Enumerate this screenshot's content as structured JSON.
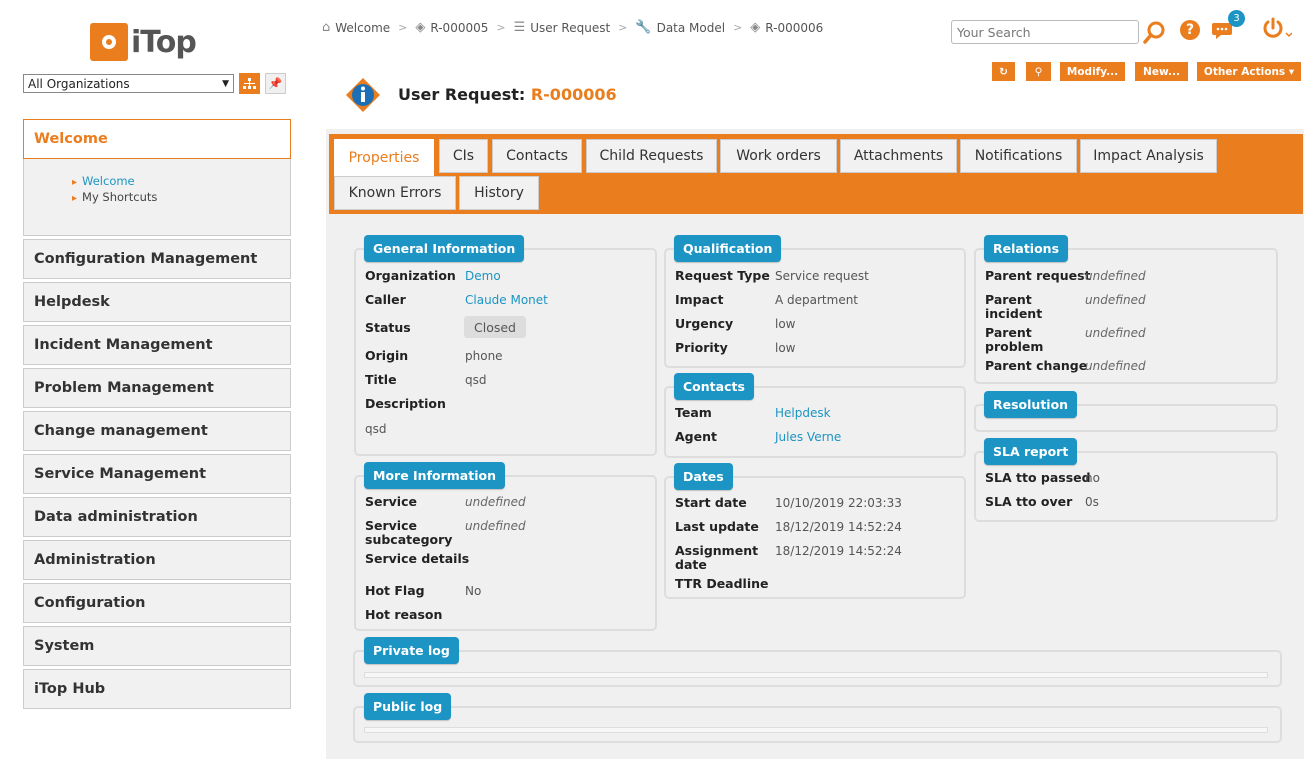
{
  "app": {
    "logo_text": "iTop"
  },
  "sidebar": {
    "org_select": "All Organizations",
    "welcome": {
      "label": "Welcome",
      "items": [
        "Welcome",
        "My Shortcuts"
      ]
    },
    "menus": [
      "Configuration Management",
      "Helpdesk",
      "Incident Management",
      "Problem Management",
      "Change management",
      "Service Management",
      "Data administration",
      "Administration",
      "Configuration",
      "System",
      "iTop Hub"
    ]
  },
  "breadcrumb": [
    "Welcome",
    "R-000005",
    "User Request",
    "Data Model",
    "R-000006"
  ],
  "header": {
    "search_placeholder": "Your Search",
    "notifications_count": "3",
    "help": "?"
  },
  "actions": {
    "refresh": "↻",
    "search": "⚲",
    "modify": "Modify...",
    "new": "New...",
    "other": "Other Actions ▾"
  },
  "title": {
    "prefix": "User Request:",
    "ref": "R-000006"
  },
  "tabs": [
    "Properties",
    "CIs",
    "Contacts",
    "Child Requests",
    "Work orders",
    "Attachments",
    "Notifications",
    "Impact Analysis",
    "Known Errors",
    "History"
  ],
  "general": {
    "legend": "General Information",
    "fields": {
      "organization": {
        "label": "Organization",
        "value": "Demo"
      },
      "caller": {
        "label": "Caller",
        "value": "Claude Monet"
      },
      "status": {
        "label": "Status",
        "value": "Closed"
      },
      "origin": {
        "label": "Origin",
        "value": "phone"
      },
      "title": {
        "label": "Title",
        "value": "qsd"
      },
      "description": {
        "label": "Description",
        "value": "qsd"
      }
    }
  },
  "more": {
    "legend": "More Information",
    "fields": {
      "service": {
        "label": "Service",
        "value": "undefined"
      },
      "subcategory": {
        "label": "Service subcategory",
        "value": "undefined"
      },
      "details": {
        "label": "Service details",
        "value": ""
      },
      "hotflag": {
        "label": "Hot Flag",
        "value": "No"
      },
      "hotreason": {
        "label": "Hot reason",
        "value": ""
      }
    }
  },
  "qualification": {
    "legend": "Qualification",
    "fields": {
      "type": {
        "label": "Request Type",
        "value": "Service request"
      },
      "impact": {
        "label": "Impact",
        "value": "A department"
      },
      "urgency": {
        "label": "Urgency",
        "value": "low"
      },
      "priority": {
        "label": "Priority",
        "value": "low"
      }
    }
  },
  "contacts": {
    "legend": "Contacts",
    "fields": {
      "team": {
        "label": "Team",
        "value": "Helpdesk"
      },
      "agent": {
        "label": "Agent",
        "value": "Jules Verne"
      }
    }
  },
  "dates": {
    "legend": "Dates",
    "fields": {
      "start": {
        "label": "Start date",
        "value": "10/10/2019 22:03:33"
      },
      "update": {
        "label": "Last update",
        "value": "18/12/2019 14:52:24"
      },
      "assign": {
        "label": "Assignment date",
        "value": "18/12/2019 14:52:24"
      },
      "ttr": {
        "label": "TTR Deadline",
        "value": ""
      }
    }
  },
  "relations": {
    "legend": "Relations",
    "fields": {
      "parent_request": {
        "label": "Parent request",
        "value": "undefined"
      },
      "parent_incident": {
        "label": "Parent incident",
        "value": "undefined"
      },
      "parent_problem": {
        "label": "Parent problem",
        "value": "undefined"
      },
      "parent_change": {
        "label": "Parent change",
        "value": "undefined"
      }
    }
  },
  "resolution": {
    "legend": "Resolution"
  },
  "sla": {
    "legend": "SLA report",
    "fields": {
      "tto_passed": {
        "label": "SLA tto passed",
        "value": "no"
      },
      "tto_over": {
        "label": "SLA tto over",
        "value": "0s"
      }
    }
  },
  "private_log": {
    "legend": "Private log"
  },
  "public_log": {
    "legend": "Public log"
  },
  "colors": {
    "accent": "#ea7d1e",
    "legend": "#1c94c4",
    "link": "#1c94c4"
  }
}
